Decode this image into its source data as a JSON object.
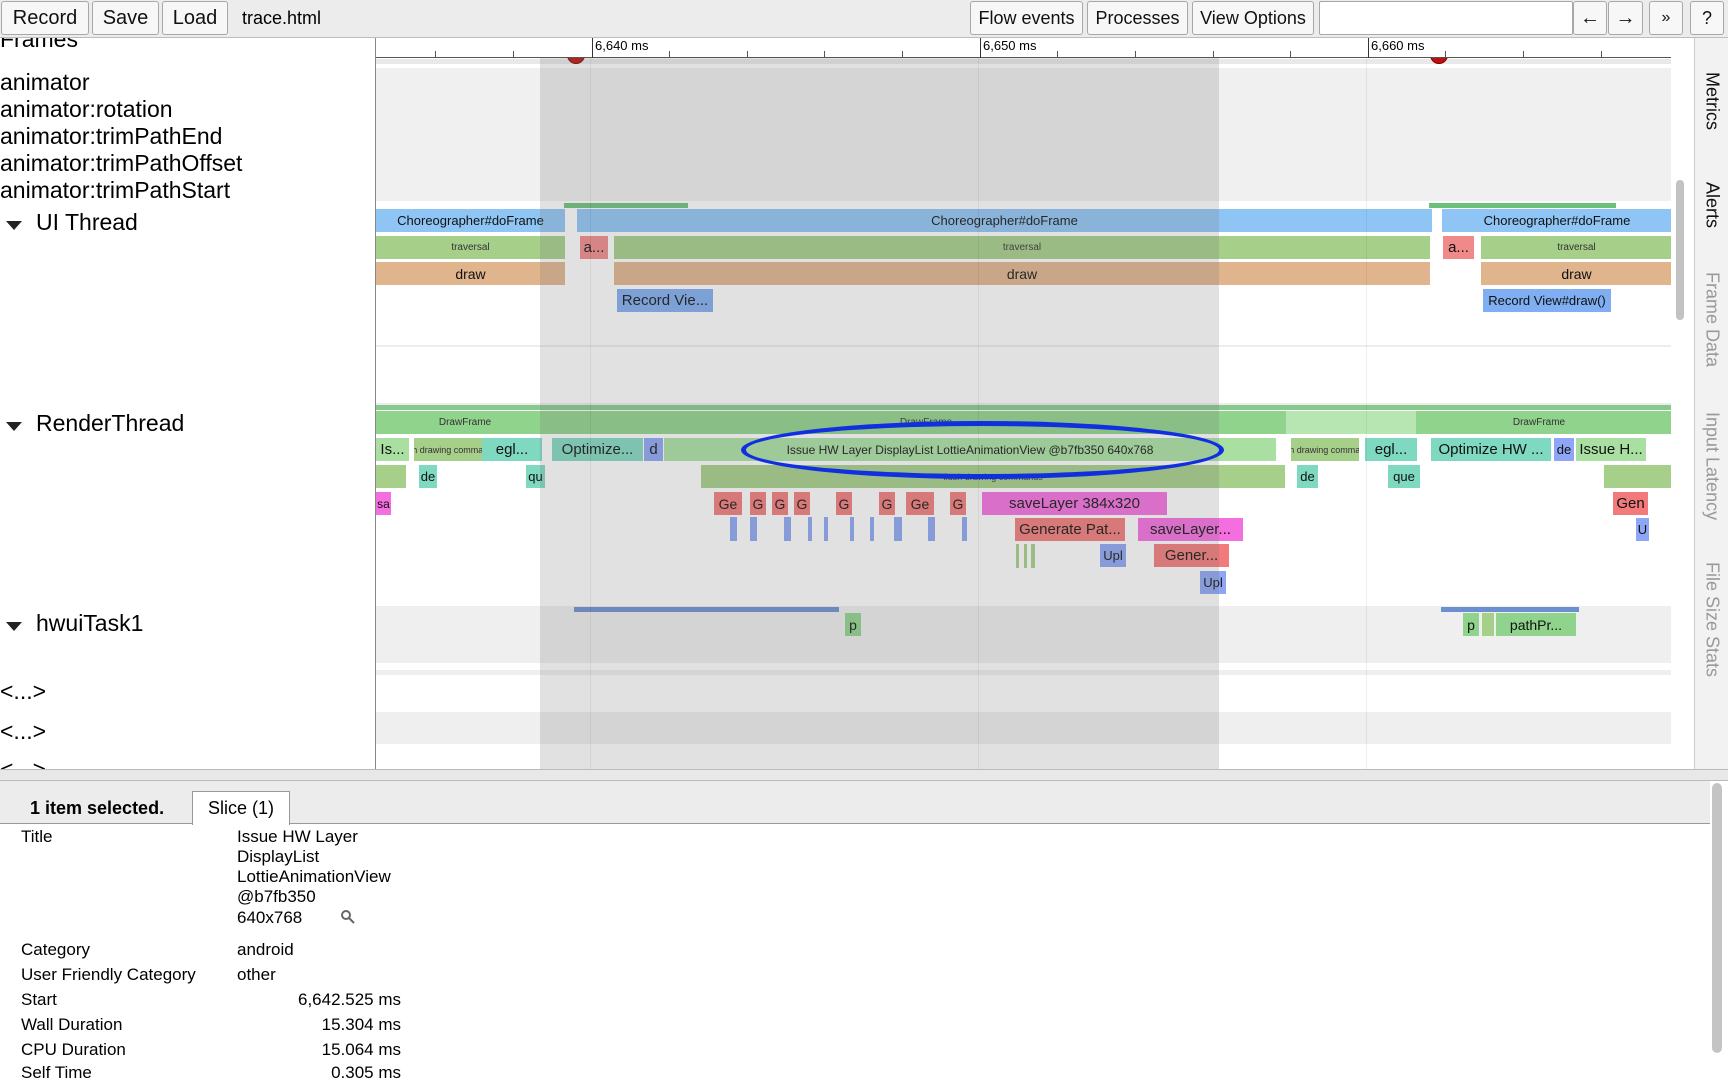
{
  "toolbar": {
    "record_label": "Record",
    "save_label": "Save",
    "load_label": "Load",
    "trace_name": "trace.html",
    "flow_events_label": "Flow events",
    "processes_label": "Processes",
    "view_options_label": "View Options",
    "search_value": "",
    "prev_label": "←",
    "next_label": "→",
    "more_label": "»",
    "help_label": "?"
  },
  "tracks": {
    "frames_label": "Frames",
    "animators": [
      "animator",
      "animator:rotation",
      "animator:trimPathEnd",
      "animator:trimPathOffset",
      "animator:trimPathStart"
    ],
    "ui_thread_label": "UI Thread",
    "render_thread_label": "RenderThread",
    "hwui_task_label": "hwuiTask1",
    "collapsed_1": "<...>",
    "collapsed_2": "<...>",
    "collapsed_3": "<...>"
  },
  "ruler": {
    "ticks": [
      "6,640 ms",
      "6,650 ms",
      "6,660 ms"
    ]
  },
  "slices": {
    "ui": {
      "choreo_1": "Choreographer#doFrame",
      "choreo_2": "Choreographer#doFrame",
      "choreo_3": "Choreographer#doFrame",
      "traversal_1": "traversal",
      "traversal_2": "traversal",
      "traversal_3": "traversal",
      "anim_1": "a...",
      "anim_2": "a...",
      "draw_1": "draw",
      "draw_2": "draw",
      "draw_3": "draw",
      "record_1": "Record Vie...",
      "record_2": "Record View#draw()"
    },
    "render": {
      "drawframe_1": "DrawFrame",
      "drawframe_2": "DrawFrame",
      "drawframe_3": "DrawFrame",
      "is": "Is...",
      "flush_1": "flush drawing commands",
      "egl_1": "egl...",
      "optimize_1": "Optimize...",
      "d": "d",
      "issue_hw": "Issue HW Layer DisplayList LottieAnimationView @b7fb350 640x768",
      "flush_2": "flush drawing commands",
      "egl_2": "egl...",
      "optimize_hw": "Optimize HW ...",
      "de_r": "de",
      "issue_h": "Issue H...",
      "flush_inner": "flush drawing commands",
      "de_1": "de",
      "qu": "qu",
      "de_2": "de",
      "que": "que",
      "sa": "sa",
      "g_labels": [
        "Ge",
        "G",
        "G",
        "G",
        "G",
        "G",
        "Ge",
        "G"
      ],
      "save_layer_big": "saveLayer 384x320",
      "gen_right": "Gen",
      "generate_path": "Generate Pat...",
      "save_layer_small": "saveLayer...",
      "u": "U",
      "upl_1": "Upl",
      "gener": "Gener...",
      "upl_2": "Upl"
    },
    "hwui": {
      "p_1": "p",
      "p_2": "p",
      "path_pr": "pathPr..."
    }
  },
  "side_tabs": [
    "Metrics",
    "Alerts",
    "Frame Data",
    "Input Latency",
    "File Size Stats"
  ],
  "panel": {
    "selected_count": "1 item selected.",
    "tab_label": "Slice (1)",
    "props": {
      "title_key": "Title",
      "title_lines": [
        "Issue HW Layer",
        "DisplayList",
        "LottieAnimationView",
        "@b7fb350",
        "640x768"
      ],
      "category_key": "Category",
      "category_val": "android",
      "ufc_key": "User Friendly Category",
      "ufc_val": "other",
      "start_key": "Start",
      "start_val": "6,642.525 ms",
      "wall_key": "Wall Duration",
      "wall_val": "15.304 ms",
      "cpu_key": "CPU Duration",
      "cpu_val": "15.064 ms",
      "self_key": "Self Time",
      "self_val": "0.305 ms"
    }
  },
  "colors": {
    "choreographer": "#8fc5f5",
    "traversal": "#a6cf8a",
    "draw": "#e0b48c",
    "record": "#7faef3",
    "anim": "#f08a8a",
    "drawframe": "#8fd38c",
    "issue_layer": "#a9e0a2",
    "generate": "#f27a7a",
    "save_layer": "#f56ee0",
    "upload": "#8ea6f5",
    "teal": "#7fd9c0",
    "highlight": "#1030e0"
  }
}
